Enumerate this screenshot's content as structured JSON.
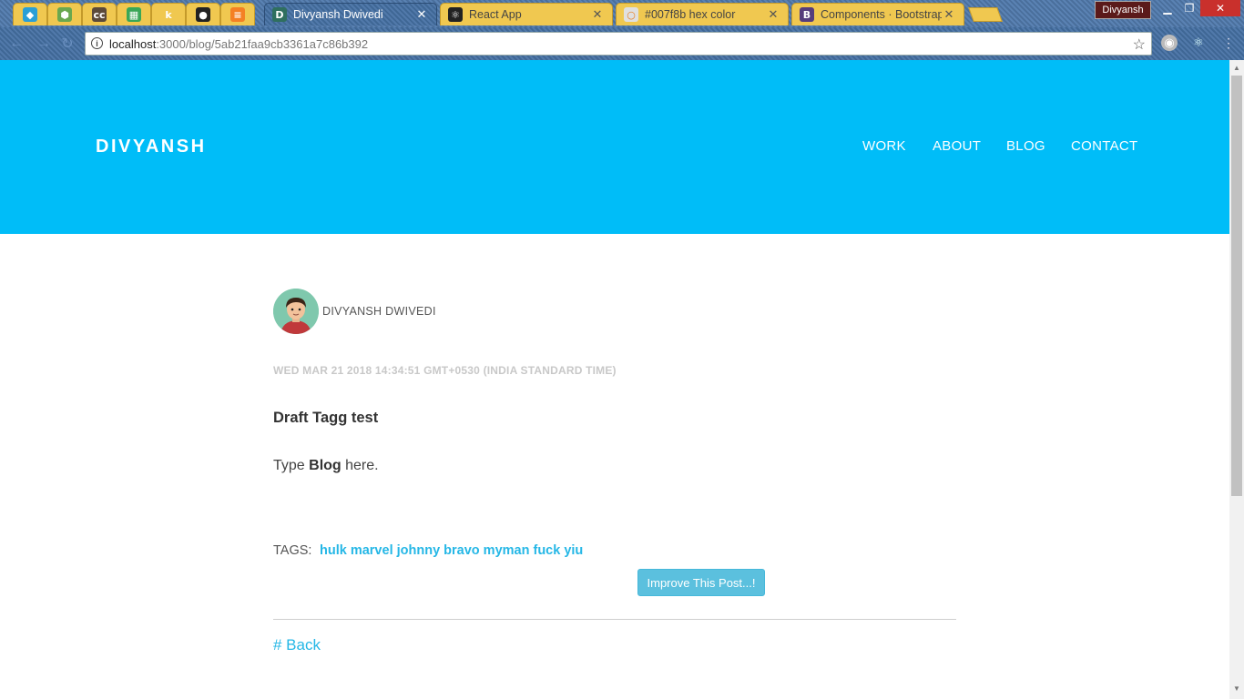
{
  "browser": {
    "pinned_tabs": [
      {
        "icon": "bird-icon",
        "glyph": "◆",
        "bg": "#2a9fd6"
      },
      {
        "icon": "nodejs-icon",
        "glyph": "⬢",
        "bg": "#6aa84f"
      },
      {
        "icon": "cc-icon",
        "glyph": "cc",
        "bg": "#5b4a3a"
      },
      {
        "icon": "sheets-icon",
        "glyph": "▦",
        "bg": "#3aa757"
      },
      {
        "icon": "k-icon",
        "glyph": "k",
        "bg": "#f0c850"
      },
      {
        "icon": "github-icon",
        "glyph": "●",
        "bg": "#222222"
      },
      {
        "icon": "stackoverflow-icon",
        "glyph": "≡",
        "bg": "#f48024"
      }
    ],
    "tabs": [
      {
        "title": "Divyansh Dwivedi",
        "icon_glyph": "D",
        "icon_bg": "#2f6f5f",
        "active": true
      },
      {
        "title": "React App",
        "icon_glyph": "⚛",
        "icon_bg": "#222222",
        "active": false
      },
      {
        "title": "#007f8b hex color",
        "icon_glyph": "○",
        "icon_bg": "#e0e0e0",
        "active": false
      },
      {
        "title": "Components · Bootstrap",
        "icon_glyph": "B",
        "icon_bg": "#563d7c",
        "active": false
      }
    ],
    "profile_name": "Divyansh",
    "url_host": "localhost",
    "url_rest": ":3000/blog/5ab21faa9cb3361a7c86b392"
  },
  "site": {
    "brand": "DIVYANSH",
    "nav": [
      "WORK",
      "ABOUT",
      "BLOG",
      "CONTACT"
    ]
  },
  "post": {
    "author": "DIVYANSH DWIVEDI",
    "date": "WED MAR 21 2018 14:34:51 GMT+0530 (INDIA STANDARD TIME)",
    "title": "Draft Tagg test",
    "body_before": "Type ",
    "body_bold": "Blog",
    "body_after": " here.",
    "tags_label": "TAGS:",
    "tags": "hulk marvel johnny bravo myman fuck yiu",
    "improve_button": "Improve This Post...!",
    "back_link": "# Back"
  },
  "colors": {
    "hero": "#00bdf8",
    "accent": "#25b7e6",
    "button": "#5bc0de"
  }
}
